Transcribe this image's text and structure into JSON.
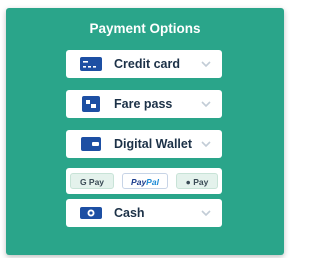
{
  "title": "Payment Options",
  "accent_color": "#2aa58a",
  "options": [
    {
      "label": "Credit card",
      "icon": "credit-card-icon"
    },
    {
      "label": "Fare pass",
      "icon": "fare-pass-icon"
    },
    {
      "label": "Digital Wallet",
      "icon": "wallet-icon"
    },
    {
      "label": "Cash",
      "icon": "cash-icon"
    }
  ],
  "wallets": {
    "gpay": "G Pay",
    "paypal_a": "Pay",
    "paypal_b": "Pal",
    "applepay": "Pay"
  }
}
